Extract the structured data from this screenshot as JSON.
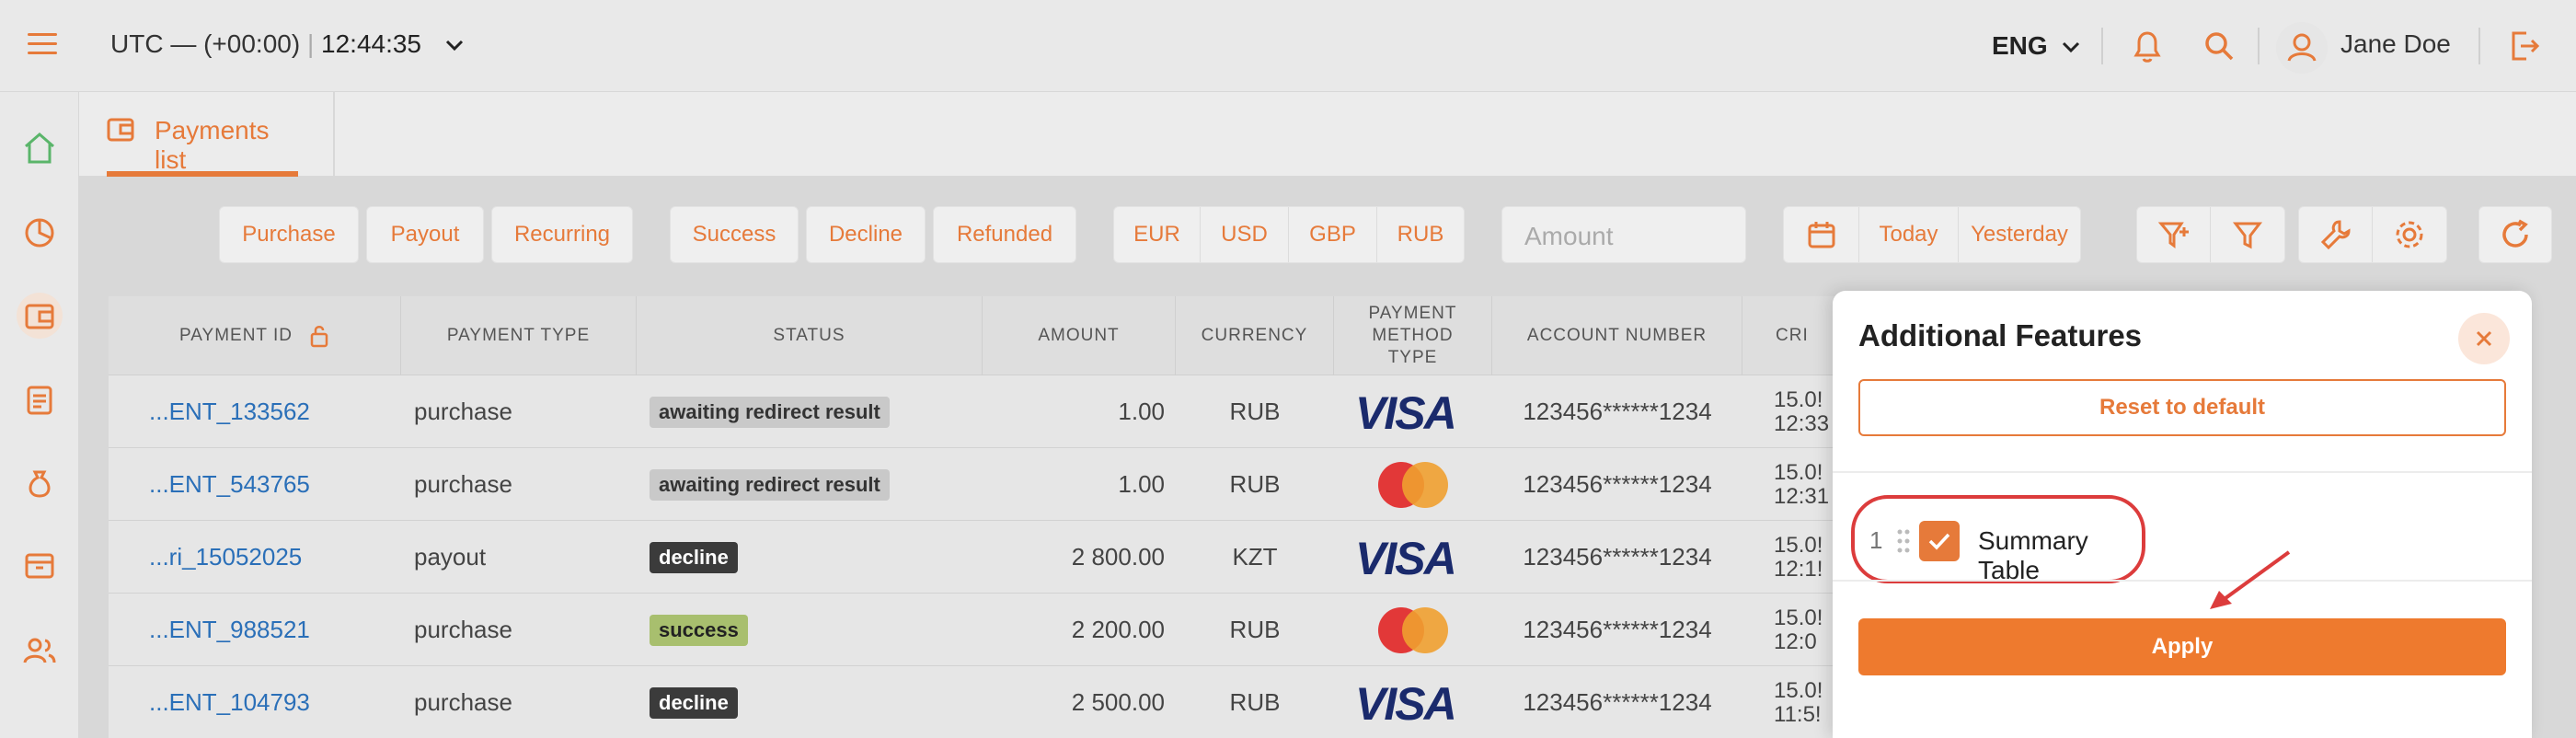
{
  "header": {
    "timezone_label": "UTC — (+00:00)",
    "time": "12:44:35",
    "language": "ENG",
    "username": "Jane Doe"
  },
  "tabs": [
    {
      "label": "Payments list"
    }
  ],
  "filters": {
    "types": [
      "Purchase",
      "Payout",
      "Recurring"
    ],
    "statuses": [
      "Success",
      "Decline",
      "Refunded"
    ],
    "currencies": [
      "EUR",
      "USD",
      "GBP",
      "RUB"
    ],
    "amount_placeholder": "Amount",
    "dates": [
      "Today",
      "Yesterday"
    ]
  },
  "table": {
    "columns": [
      "PAYMENT ID",
      "PAYMENT TYPE",
      "STATUS",
      "AMOUNT",
      "CURRENCY",
      "PAYMENT METHOD TYPE",
      "ACCOUNT NUMBER",
      "CRI"
    ],
    "rows": [
      {
        "id": "...ENT_133562",
        "type": "purchase",
        "status": "awaiting redirect result",
        "status_kind": "await",
        "amount": "1.00",
        "currency": "RUB",
        "method": "visa",
        "account": "123456******1234",
        "created_1": "15.0!",
        "created_2": "12:33"
      },
      {
        "id": "...ENT_543765",
        "type": "purchase",
        "status": "awaiting redirect result",
        "status_kind": "await",
        "amount": "1.00",
        "currency": "RUB",
        "method": "mastercard",
        "account": "123456******1234",
        "created_1": "15.0!",
        "created_2": "12:31"
      },
      {
        "id": "...ri_15052025",
        "type": "payout",
        "status": "decline",
        "status_kind": "decline",
        "amount": "2 800.00",
        "currency": "KZT",
        "method": "visa",
        "account": "123456******1234",
        "created_1": "15.0!",
        "created_2": "12:1!"
      },
      {
        "id": "...ENT_988521",
        "type": "purchase",
        "status": "success",
        "status_kind": "success",
        "amount": "2 200.00",
        "currency": "RUB",
        "method": "mastercard",
        "account": "123456******1234",
        "created_1": "15.0!",
        "created_2": "12:0"
      },
      {
        "id": "...ENT_104793",
        "type": "purchase",
        "status": "decline",
        "status_kind": "decline",
        "amount": "2 500.00",
        "currency": "RUB",
        "method": "visa",
        "account": "123456******1234",
        "created_1": "15.0!",
        "created_2": "11:5!"
      }
    ]
  },
  "modal": {
    "title": "Additional Features",
    "reset_label": "Reset to default",
    "items": [
      {
        "index": "1",
        "label": "Summary Table",
        "checked": true
      }
    ],
    "apply_label": "Apply"
  },
  "colors": {
    "accent": "#e67a3a",
    "highlight": "#dc3c3c",
    "link": "#2a6fb8"
  },
  "icons": [
    "menu-icon",
    "chevron-down-icon",
    "bell-icon",
    "search-icon",
    "user-icon",
    "logout-icon",
    "home-icon",
    "pie-chart-icon",
    "wallet-icon",
    "document-icon",
    "money-bag-icon",
    "archive-icon",
    "users-icon",
    "lock-icon",
    "calendar-icon",
    "filter-plus-icon",
    "filter-icon",
    "wrench-icon",
    "gear-icon",
    "refresh-icon",
    "close-icon",
    "drag-handle-icon",
    "check-icon",
    "arrow-icon"
  ]
}
